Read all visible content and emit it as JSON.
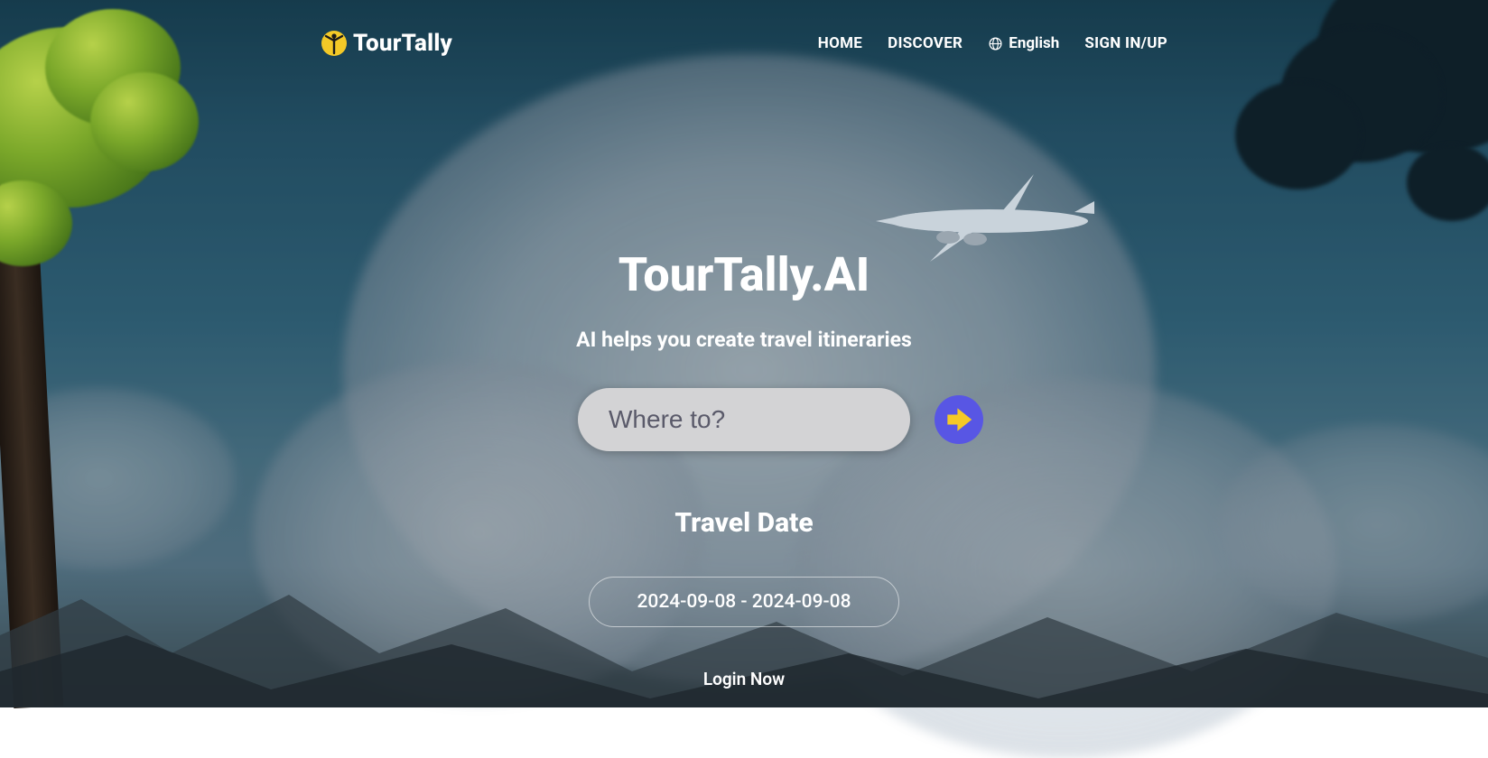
{
  "brand": {
    "name": "TourTally"
  },
  "nav": {
    "home": "HOME",
    "discover": "DISCOVER",
    "language": "English",
    "auth": "SIGN IN/UP"
  },
  "hero": {
    "title": "TourTally.AI",
    "subtitle": "AI helps you create travel itineraries",
    "search_placeholder": "Where to?",
    "date_title": "Travel Date",
    "date_value": "2024-09-08 - 2024-09-08",
    "login_now": "Login Now"
  }
}
